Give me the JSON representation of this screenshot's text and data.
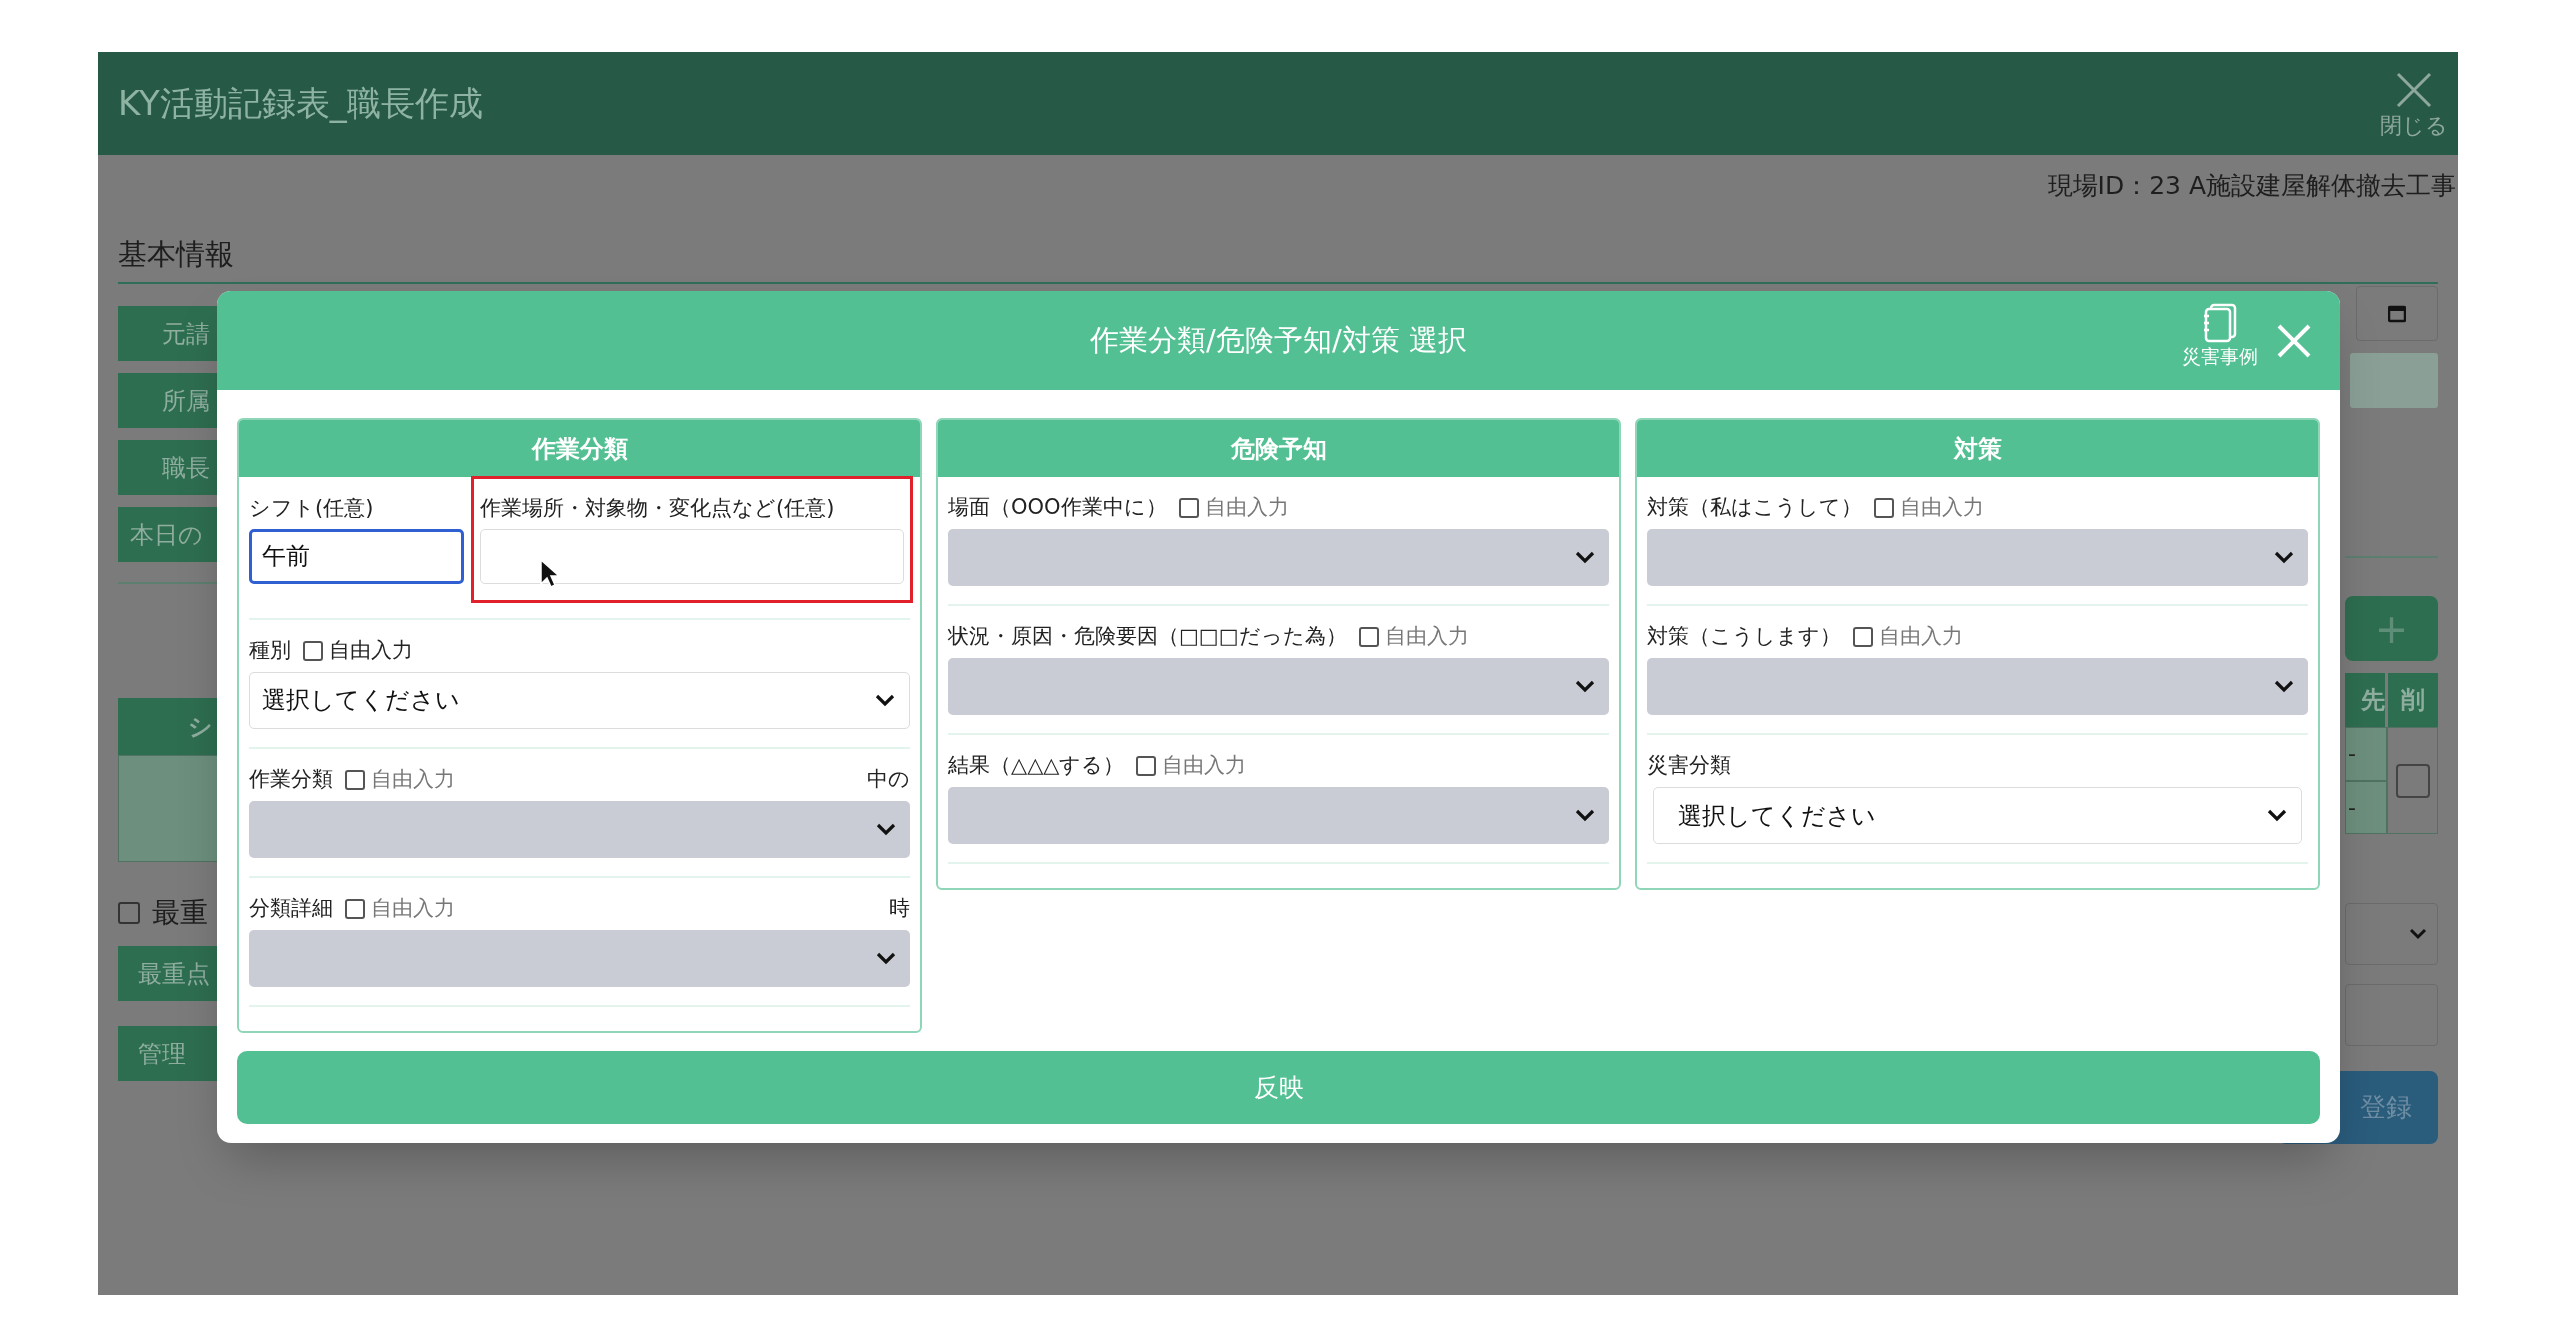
{
  "app": {
    "title": "KY活動記録表_職長作成",
    "close_label": "閉じる",
    "site_id": "現場ID：23 A施設建屋解体撤去工事",
    "section_title": "基本情報",
    "left_buttons": [
      "元請",
      "所属",
      "職長",
      "本日の"
    ],
    "table_header": "シ",
    "priority_check": {
      "label": "最重",
      "checked": false
    },
    "lower_buttons": [
      "最重点",
      "管理"
    ],
    "add_button": "+",
    "right_headers": [
      "先",
      "削"
    ],
    "right_cells": [
      "-",
      "-"
    ],
    "delete_check": {
      "checked": false
    },
    "register_button": "登録"
  },
  "modal": {
    "title": "作業分類/危険予知/対策 選択",
    "case_button": "災害事例",
    "apply_button": "反映",
    "columns": [
      {
        "heading": "作業分類",
        "rows": [
          {
            "kind": "text_pair",
            "fields": [
              {
                "label": "シフト(任意)",
                "value": "午前",
                "focused": true,
                "highlighted": false
              },
              {
                "label": "作業場所・対象物・変化点など(任意)",
                "focused": false,
                "highlighted": true
              }
            ]
          },
          {
            "kind": "select",
            "label": "種別",
            "free_input": {
              "label": "自由入力",
              "checked": false
            },
            "value": "選択してください",
            "disabled": false
          },
          {
            "kind": "select",
            "label": "作業分類",
            "free_input": {
              "label": "自由入力",
              "checked": false
            },
            "note": "中の",
            "disabled": true
          },
          {
            "kind": "select",
            "label": "分類詳細",
            "free_input": {
              "label": "自由入力",
              "checked": false
            },
            "note": "時",
            "disabled": true
          }
        ]
      },
      {
        "heading": "危険予知",
        "rows": [
          {
            "kind": "select",
            "label": "場面（OOO作業中に）",
            "free_input": {
              "label": "自由入力",
              "checked": false
            },
            "disabled": true
          },
          {
            "kind": "select",
            "label": "状況・原因・危険要因（□□□だった為）",
            "free_input": {
              "label": "自由入力",
              "checked": false
            },
            "disabled": true
          },
          {
            "kind": "select",
            "label": "結果（△△△する）",
            "free_input": {
              "label": "自由入力",
              "checked": false
            },
            "disabled": true
          }
        ]
      },
      {
        "heading": "対策",
        "rows": [
          {
            "kind": "select",
            "label": "対策（私はこうして）",
            "free_input": {
              "label": "自由入力",
              "checked": false
            },
            "disabled": true
          },
          {
            "kind": "select",
            "label": "対策（こうします）",
            "free_input": {
              "label": "自由入力",
              "checked": false
            },
            "disabled": true
          },
          {
            "kind": "select",
            "label": "災害分類",
            "value": "選択してください",
            "disabled": false
          }
        ]
      }
    ]
  }
}
